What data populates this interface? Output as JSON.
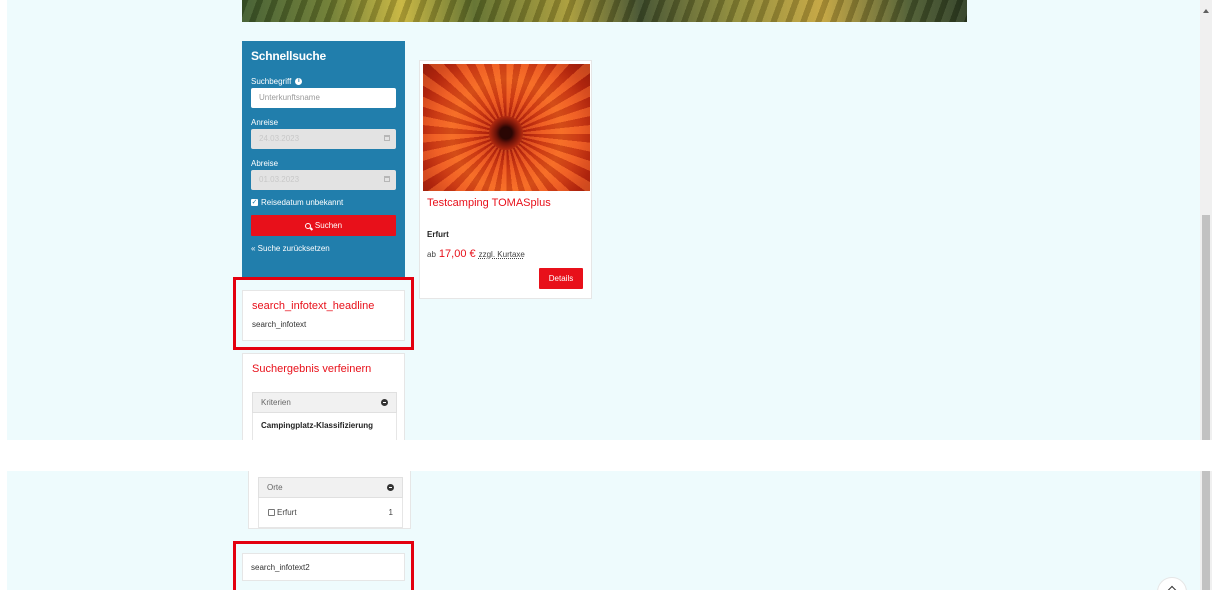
{
  "quick_search": {
    "title": "Schnellsuche",
    "search_label": "Suchbegriff",
    "search_placeholder": "Unterkunftsname",
    "arrival_label": "Anreise",
    "arrival_value": "24.03.2023",
    "departure_label": "Abreise",
    "departure_value": "01.03.2023",
    "date_unknown_label": "Reisedatum unbekannt",
    "date_unknown_checked": true,
    "search_button": "Suchen",
    "reset_link": "« Suche zurücksetzen"
  },
  "info_box": {
    "headline": "search_infotext_headline",
    "text": "search_infotext"
  },
  "refine": {
    "title": "Suchergebnis verfeinern",
    "criteria_header": "Kriterien",
    "criteria_item": "Campingplatz-Klassifizierung",
    "places_header": "Orte",
    "places": [
      {
        "label": "Erfurt",
        "count": "1"
      }
    ]
  },
  "info_box2": {
    "text": "search_infotext2"
  },
  "listing": {
    "name": "Testcamping TOMASplus",
    "location": "Erfurt",
    "price_prefix": "ab",
    "price": "17,00 €",
    "price_suffix": "zzgl. Kurtaxe",
    "details_button": "Details"
  },
  "colors": {
    "search_box_bg": "#217eac",
    "accent_red": "#e8101a",
    "page_bg": "#eefbfd",
    "highlight_border": "#e3000f"
  }
}
